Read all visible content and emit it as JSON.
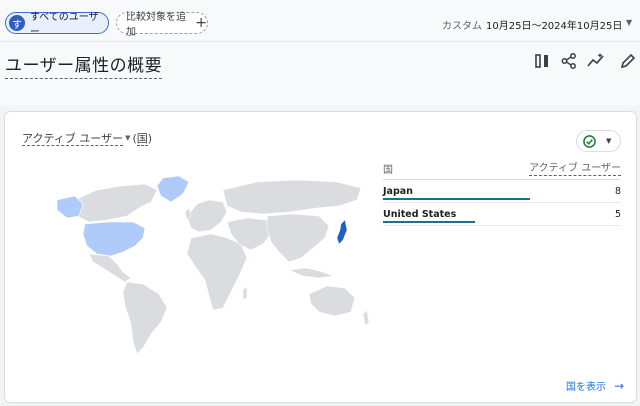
{
  "segment_bar": {
    "all_users_chip": {
      "avatar_letter": "す",
      "label": "すべてのユーザー"
    },
    "add_comparison_label": "比較対象を追加",
    "add_icon": "plus-icon"
  },
  "date": {
    "label": "カスタム",
    "range": "10月25日～2024年10月25日"
  },
  "page": {
    "title": "ユーザー属性の概要"
  },
  "toolbar_icons": [
    "compare-columns-icon",
    "share-icon",
    "insights-icon",
    "edit-pencil-icon"
  ],
  "card": {
    "title_metric": "アクティブ ユーザー",
    "title_dimension": "国",
    "status_icon": "check-circle-icon",
    "status_color": "#188038",
    "map": {
      "highlight_colors": {
        "Japan": "#1f5fbf",
        "United States": "#aecbfa",
        "Greenland": "#aecbfa",
        "other": "#dadce0"
      }
    },
    "table": {
      "col_dimension": "国",
      "col_metric": "アクティブ ユーザー",
      "rows": [
        {
          "country": "Japan",
          "value": "8",
          "fraction": 0.98
        },
        {
          "country": "United States",
          "value": "5",
          "fraction": 0.61
        }
      ],
      "bar_color": "#1f6e8c"
    },
    "view_link": "国を表示"
  }
}
